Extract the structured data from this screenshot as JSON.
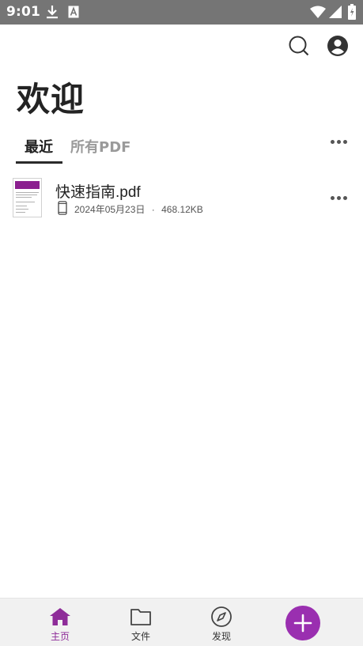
{
  "status_bar": {
    "time": "9:01",
    "icons": [
      "download-icon",
      "text-a-icon",
      "wifi-icon",
      "signal-icon",
      "battery-charging-icon"
    ]
  },
  "header": {
    "title": "欢迎",
    "actions": [
      "search-icon",
      "account-icon"
    ]
  },
  "tabs": [
    {
      "label": "最近",
      "active": true
    },
    {
      "label": "所有PDF",
      "active": false
    }
  ],
  "files": [
    {
      "name": "快速指南.pdf",
      "date": "2024年05月23日",
      "separator": "·",
      "size": "468.12KB",
      "location_icon": "phone-icon"
    }
  ],
  "bottom_nav": {
    "items": [
      {
        "label": "主页",
        "icon": "home-icon",
        "active": true
      },
      {
        "label": "文件",
        "icon": "folder-icon",
        "active": false
      },
      {
        "label": "发现",
        "icon": "compass-icon",
        "active": false
      }
    ],
    "fab_icon": "plus-icon"
  },
  "colors": {
    "accent": "#9a2fb0",
    "status_bar": "#757575",
    "nav_background": "#f1f1f1"
  }
}
